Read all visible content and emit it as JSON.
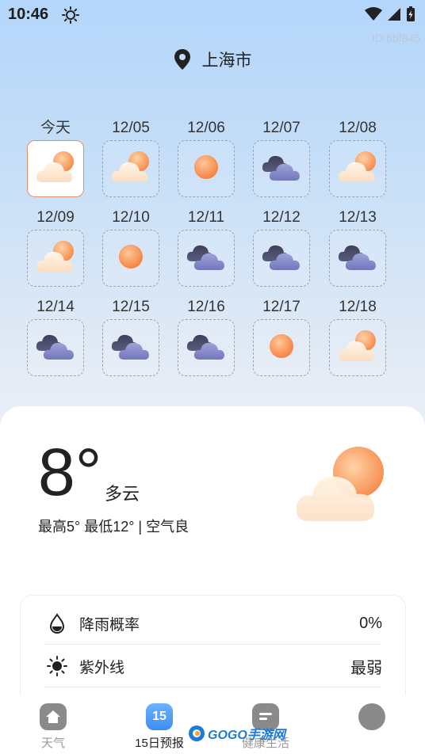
{
  "status_bar": {
    "time": "10:46",
    "id_tag": "ID:6bf845"
  },
  "location": {
    "city": "上海市"
  },
  "forecast_days": [
    {
      "label": "今天",
      "icon": "partly-cloudy"
    },
    {
      "label": "12/05",
      "icon": "partly-cloudy"
    },
    {
      "label": "12/06",
      "icon": "sunny"
    },
    {
      "label": "12/07",
      "icon": "cloudy"
    },
    {
      "label": "12/08",
      "icon": "partly-cloudy"
    },
    {
      "label": "12/09",
      "icon": "partly-cloudy"
    },
    {
      "label": "12/10",
      "icon": "sunny"
    },
    {
      "label": "12/11",
      "icon": "cloudy"
    },
    {
      "label": "12/12",
      "icon": "cloudy"
    },
    {
      "label": "12/13",
      "icon": "cloudy"
    },
    {
      "label": "12/14",
      "icon": "cloudy"
    },
    {
      "label": "12/15",
      "icon": "cloudy"
    },
    {
      "label": "12/16",
      "icon": "cloudy"
    },
    {
      "label": "12/17",
      "icon": "sunny"
    },
    {
      "label": "12/18",
      "icon": "partly-cloudy"
    }
  ],
  "selected_day": 0,
  "current": {
    "temperature": "8°",
    "condition": "多云",
    "summary": "最高5° 最低12° | 空气良",
    "icon": "partly-cloudy"
  },
  "details": [
    {
      "label": "降雨概率",
      "value": "0%",
      "icon": "drop-icon"
    },
    {
      "label": "紫外线",
      "value": "最弱",
      "icon": "sun-icon"
    }
  ],
  "nav": [
    {
      "label": "天气",
      "icon": "home-icon"
    },
    {
      "label": "15日预报",
      "icon": "calendar-15-icon",
      "badge": "15"
    },
    {
      "label": "健康生活",
      "icon": "note-icon"
    },
    {
      "label": "",
      "icon": "profile-icon"
    }
  ],
  "active_nav": 1,
  "watermark": "GOGO手游网",
  "colors": {
    "accent_orange": "#f59a5a",
    "cloud_purple": "#7d7fc4",
    "active_nav": "#3b8ef0"
  }
}
